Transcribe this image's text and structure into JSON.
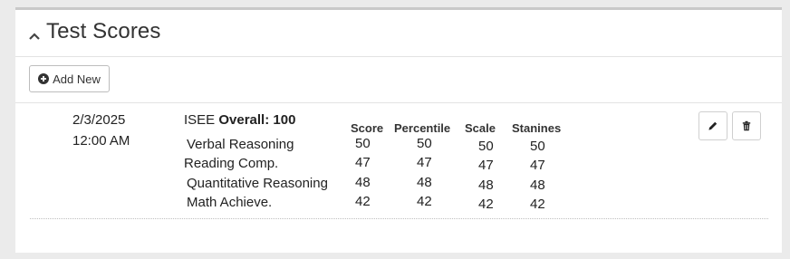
{
  "panel": {
    "title": "Test Scores",
    "add_new_label": "Add New"
  },
  "entry": {
    "date": "2/3/2025",
    "time": "12:00 AM",
    "test_name": "ISEE",
    "overall_label": "Overall:",
    "overall_value": "100",
    "columns": [
      "Score",
      "Percentile",
      "Scale",
      "Stanines"
    ],
    "rows": [
      {
        "label": "Verbal Reasoning",
        "score": "50",
        "percentile": "50",
        "scale": "50",
        "stanines": "50"
      },
      {
        "label": "Reading Comp.",
        "score": "47",
        "percentile": "47",
        "scale": "47",
        "stanines": "47"
      },
      {
        "label": "Quantitative Reasoning",
        "score": "48",
        "percentile": "48",
        "scale": "48",
        "stanines": "48"
      },
      {
        "label": "Math Achieve.",
        "score": "42",
        "percentile": "42",
        "scale": "42",
        "stanines": "42"
      }
    ]
  },
  "icons": {
    "collapse": "chevron-up-icon",
    "add": "plus-circle-icon",
    "edit": "pencil-icon",
    "delete": "trash-icon"
  }
}
